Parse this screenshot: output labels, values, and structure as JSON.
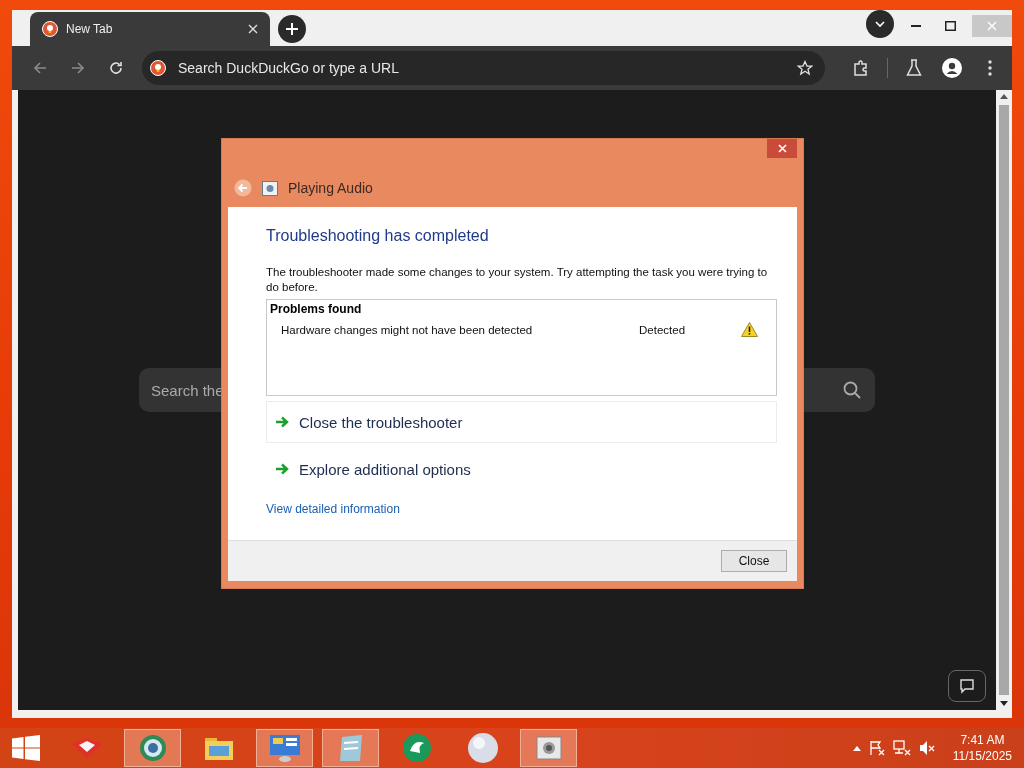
{
  "browser": {
    "tabs": [
      {
        "title": "New Tab",
        "selected": true
      }
    ],
    "address_bar": {
      "placeholder": "Search DuckDuckGo or type a URL"
    },
    "page": {
      "search": {
        "placeholder": "Search the"
      }
    }
  },
  "dialog": {
    "title": "Playing Audio",
    "heading": "Troubleshooting has completed",
    "message": "The troubleshooter made some changes to your system. Try attempting the task you were trying to do before.",
    "problems": {
      "header": "Problems found",
      "rows": [
        {
          "problem": "Hardware changes might not have been detected",
          "status": "Detected"
        }
      ]
    },
    "options": [
      {
        "label": "Close the troubleshooter",
        "selected": true
      },
      {
        "label": "Explore additional options",
        "selected": false
      }
    ],
    "link": "View detailed information",
    "buttons": [
      "Close"
    ]
  },
  "taskbar": {
    "apps": [
      {
        "kind": "fox",
        "running": false
      },
      {
        "kind": "browser",
        "running": true
      },
      {
        "kind": "folder",
        "running": false
      },
      {
        "kind": "control-panel",
        "running": true
      },
      {
        "kind": "notepad",
        "running": true
      },
      {
        "kind": "green-app",
        "running": false
      },
      {
        "kind": "sphere",
        "running": false
      },
      {
        "kind": "troubleshooter",
        "running": true
      }
    ],
    "clock": {
      "time": "7:41 AM",
      "date": "11/15/2025"
    }
  }
}
